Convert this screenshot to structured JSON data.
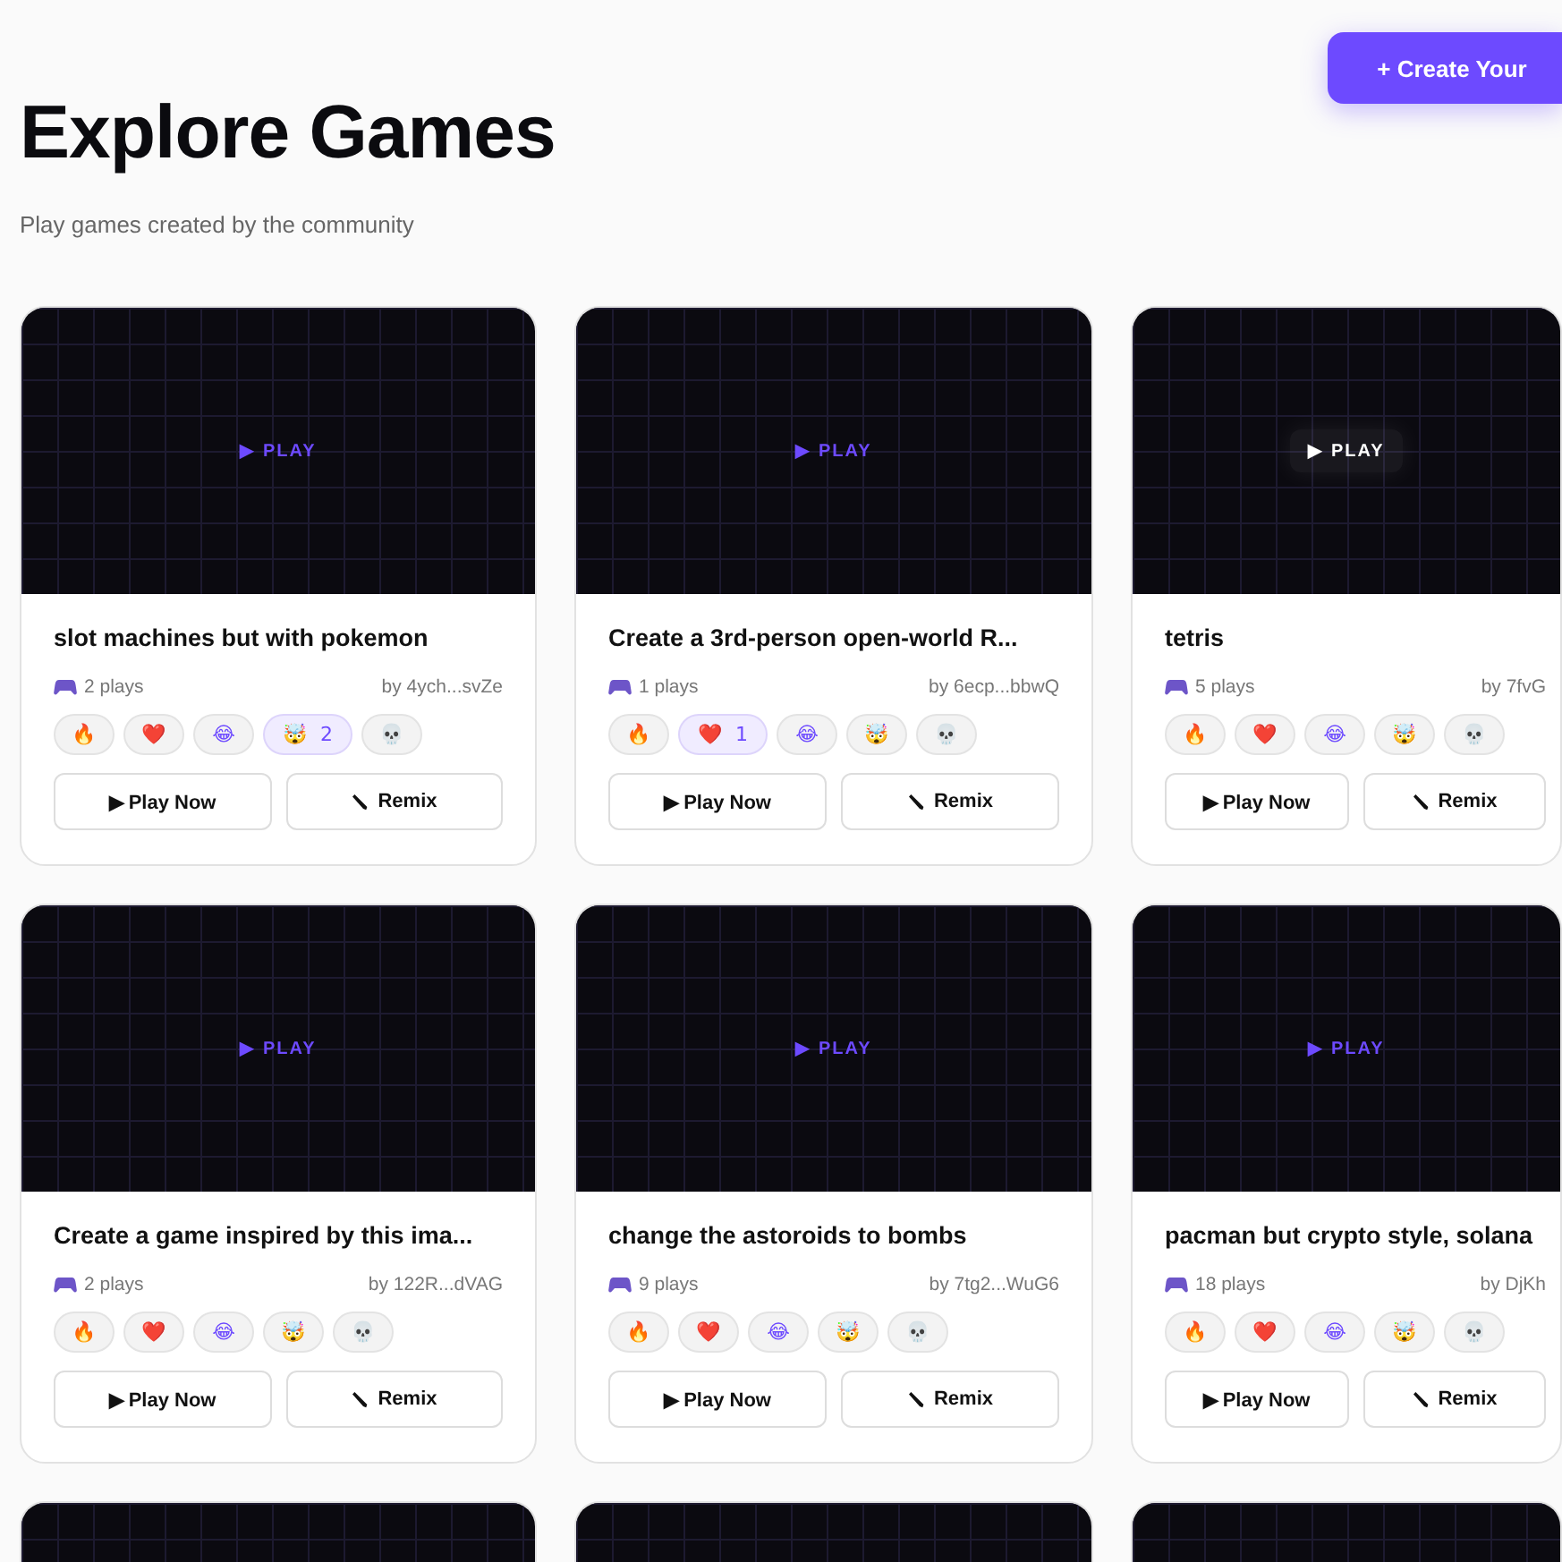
{
  "header": {
    "title": "Explore Games",
    "subtitle": "Play games created by the community",
    "create_button": "+ Create Your"
  },
  "cards": [
    {
      "kind": "full",
      "play_overlay": "▶ PLAY",
      "hovered": false,
      "title": "slot machines but with pokemon",
      "plays": "2 plays",
      "author": "by 4ych...svZe",
      "reactions": [
        {
          "emoji": "🔥",
          "reacted": false
        },
        {
          "emoji": "❤️",
          "reacted": false
        },
        {
          "emoji": "😂",
          "reacted": false
        },
        {
          "emoji": "🤯",
          "count": "2",
          "reacted": true
        },
        {
          "emoji": "💀",
          "reacted": false
        }
      ],
      "play_button": "▶ Play Now",
      "remix_button": "Remix"
    },
    {
      "kind": "full",
      "play_overlay": "▶ PLAY",
      "hovered": false,
      "title": "Create a 3rd-person open-world R...",
      "plays": "1 plays",
      "author": "by 6ecp...bbwQ",
      "reactions": [
        {
          "emoji": "🔥",
          "reacted": false
        },
        {
          "emoji": "❤️",
          "count": "1",
          "reacted": true
        },
        {
          "emoji": "😂",
          "reacted": false
        },
        {
          "emoji": "🤯",
          "reacted": false
        },
        {
          "emoji": "💀",
          "reacted": false
        }
      ],
      "play_button": "▶ Play Now",
      "remix_button": "Remix"
    },
    {
      "kind": "full",
      "play_overlay": "▶ PLAY",
      "hovered": true,
      "title": "tetris",
      "plays": "5 plays",
      "author": "by 7fvG",
      "reactions": [
        {
          "emoji": "🔥",
          "reacted": false
        },
        {
          "emoji": "❤️",
          "reacted": false
        },
        {
          "emoji": "😂",
          "reacted": false
        },
        {
          "emoji": "🤯",
          "reacted": false
        },
        {
          "emoji": "💀",
          "reacted": false
        }
      ],
      "play_button": "▶ Play Now",
      "remix_button": "Remix"
    },
    {
      "kind": "full",
      "play_overlay": "▶ PLAY",
      "hovered": false,
      "title": "Create a game inspired by this ima...",
      "plays": "2 plays",
      "author": "by 122R...dVAG",
      "reactions": [
        {
          "emoji": "🔥",
          "reacted": false
        },
        {
          "emoji": "❤️",
          "reacted": false
        },
        {
          "emoji": "😂",
          "reacted": false
        },
        {
          "emoji": "🤯",
          "reacted": false
        },
        {
          "emoji": "💀",
          "reacted": false
        }
      ],
      "play_button": "▶ Play Now",
      "remix_button": "Remix"
    },
    {
      "kind": "full",
      "play_overlay": "▶ PLAY",
      "hovered": false,
      "title": "change the astoroids to bombs",
      "plays": "9 plays",
      "author": "by 7tg2...WuG6",
      "reactions": [
        {
          "emoji": "🔥",
          "reacted": false
        },
        {
          "emoji": "❤️",
          "reacted": false
        },
        {
          "emoji": "😂",
          "reacted": false
        },
        {
          "emoji": "🤯",
          "reacted": false
        },
        {
          "emoji": "💀",
          "reacted": false
        }
      ],
      "play_button": "▶ Play Now",
      "remix_button": "Remix"
    },
    {
      "kind": "full",
      "play_overlay": "▶ PLAY",
      "hovered": false,
      "title": "pacman but crypto style, solana",
      "plays": "18 plays",
      "author": "by DjKh",
      "reactions": [
        {
          "emoji": "🔥",
          "reacted": false
        },
        {
          "emoji": "❤️",
          "reacted": false
        },
        {
          "emoji": "😂",
          "reacted": false
        },
        {
          "emoji": "🤯",
          "reacted": false
        },
        {
          "emoji": "💀",
          "reacted": false
        }
      ],
      "play_button": "▶ Play Now",
      "remix_button": "Remix"
    },
    {
      "kind": "peek"
    },
    {
      "kind": "peek"
    },
    {
      "kind": "peek"
    }
  ]
}
